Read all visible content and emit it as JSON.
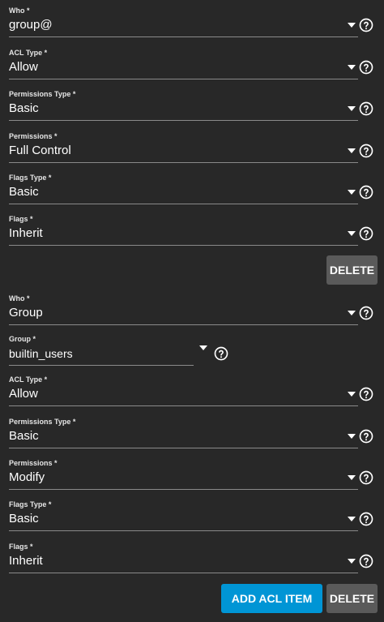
{
  "ace1": {
    "who": {
      "label": "Who *",
      "value": "group@"
    },
    "acl_type": {
      "label": "ACL Type *",
      "value": "Allow"
    },
    "permissions_type": {
      "label": "Permissions Type *",
      "value": "Basic"
    },
    "permissions": {
      "label": "Permissions *",
      "value": "Full Control"
    },
    "flags_type": {
      "label": "Flags Type *",
      "value": "Basic"
    },
    "flags": {
      "label": "Flags *",
      "value": "Inherit"
    },
    "delete_label": "DELETE"
  },
  "ace2": {
    "who": {
      "label": "Who *",
      "value": "Group"
    },
    "group": {
      "label": "Group *",
      "value": "builtin_users"
    },
    "acl_type": {
      "label": "ACL Type *",
      "value": "Allow"
    },
    "permissions_type": {
      "label": "Permissions Type *",
      "value": "Basic"
    },
    "permissions": {
      "label": "Permissions *",
      "value": "Modify"
    },
    "flags_type": {
      "label": "Flags Type *",
      "value": "Basic"
    },
    "flags": {
      "label": "Flags *",
      "value": "Inherit"
    },
    "delete_label": "DELETE"
  },
  "actions": {
    "add_acl_item_label": "ADD ACL ITEM"
  },
  "colors": {
    "background": "#282828",
    "primary": "#0095d5",
    "delete_button": "#5a5a5a"
  },
  "icons": {
    "dropdown": "chevron-down-icon",
    "help": "help-circle-icon"
  }
}
